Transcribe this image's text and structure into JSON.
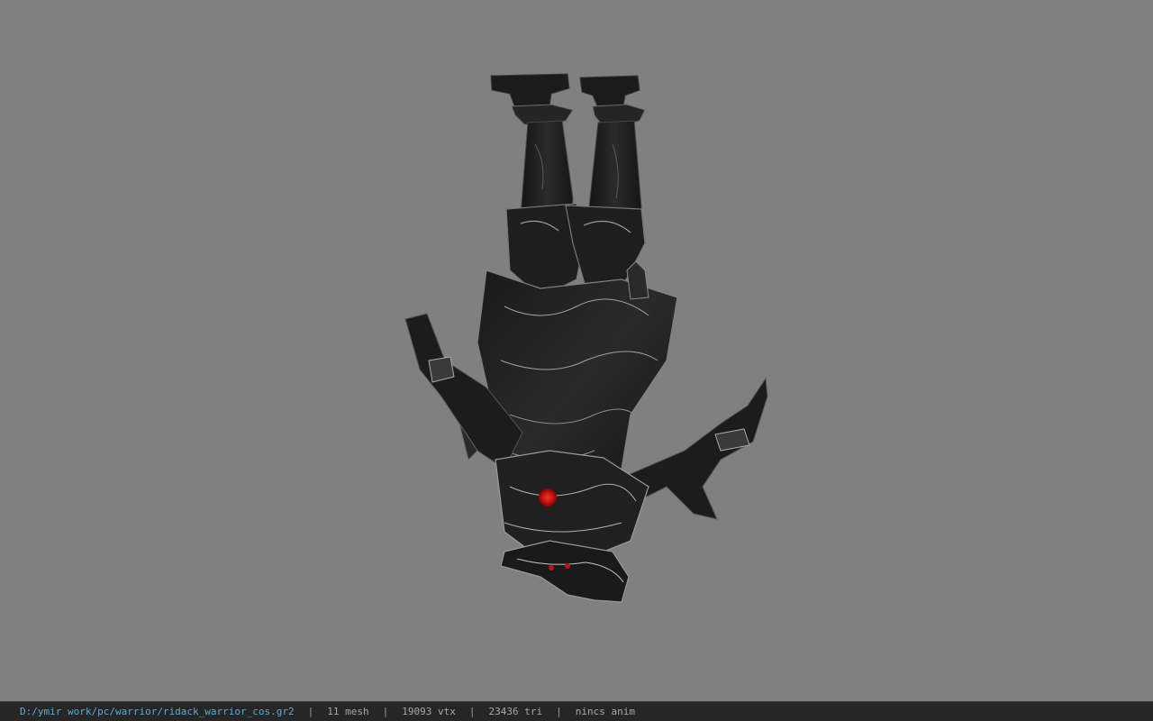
{
  "status_bar": {
    "file_path": "D:/ymir work/pc/warrior/ridack_warrior_cos.gr2",
    "separator": "|",
    "mesh_count": "11 mesh",
    "vertex_count": "19093 vtx",
    "triangle_count": "23436 tri",
    "animation": "nincs anim"
  },
  "colors": {
    "background": "#808080",
    "status_bar_bg": "#262626",
    "path_color": "#5fa8d8",
    "armor_dark": "#1c1c1c",
    "armor_highlight": "#9a9a9a",
    "gem_red": "#e01010"
  }
}
